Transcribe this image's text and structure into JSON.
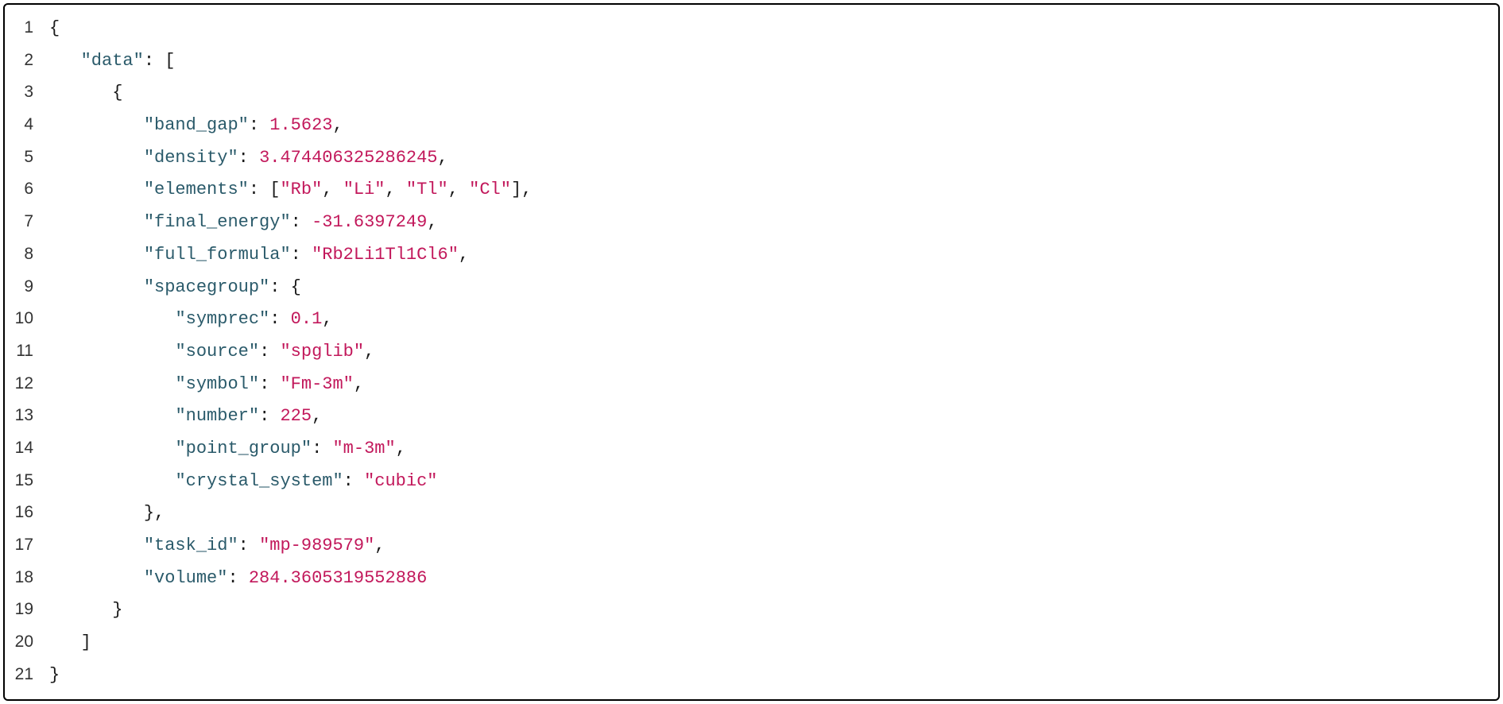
{
  "lines": [
    {
      "num": "1",
      "indent": 0,
      "tokens": [
        {
          "t": "punct",
          "v": "{"
        }
      ]
    },
    {
      "num": "2",
      "indent": 1,
      "tokens": [
        {
          "t": "key",
          "v": "\"data\""
        },
        {
          "t": "colon",
          "v": ": "
        },
        {
          "t": "punct",
          "v": "["
        }
      ]
    },
    {
      "num": "3",
      "indent": 2,
      "tokens": [
        {
          "t": "punct",
          "v": "{"
        }
      ]
    },
    {
      "num": "4",
      "indent": 3,
      "tokens": [
        {
          "t": "key",
          "v": "\"band_gap\""
        },
        {
          "t": "colon",
          "v": ": "
        },
        {
          "t": "number",
          "v": "1.5623"
        },
        {
          "t": "punct",
          "v": ","
        }
      ]
    },
    {
      "num": "5",
      "indent": 3,
      "tokens": [
        {
          "t": "key",
          "v": "\"density\""
        },
        {
          "t": "colon",
          "v": ": "
        },
        {
          "t": "number",
          "v": "3.474406325286245"
        },
        {
          "t": "punct",
          "v": ","
        }
      ]
    },
    {
      "num": "6",
      "indent": 3,
      "tokens": [
        {
          "t": "key",
          "v": "\"elements\""
        },
        {
          "t": "colon",
          "v": ": "
        },
        {
          "t": "punct",
          "v": "["
        },
        {
          "t": "string",
          "v": "\"Rb\""
        },
        {
          "t": "punct",
          "v": ", "
        },
        {
          "t": "string",
          "v": "\"Li\""
        },
        {
          "t": "punct",
          "v": ", "
        },
        {
          "t": "string",
          "v": "\"Tl\""
        },
        {
          "t": "punct",
          "v": ", "
        },
        {
          "t": "string",
          "v": "\"Cl\""
        },
        {
          "t": "punct",
          "v": "],"
        }
      ]
    },
    {
      "num": "7",
      "indent": 3,
      "tokens": [
        {
          "t": "key",
          "v": "\"final_energy\""
        },
        {
          "t": "colon",
          "v": ": "
        },
        {
          "t": "number",
          "v": "-31.6397249"
        },
        {
          "t": "punct",
          "v": ","
        }
      ]
    },
    {
      "num": "8",
      "indent": 3,
      "tokens": [
        {
          "t": "key",
          "v": "\"full_formula\""
        },
        {
          "t": "colon",
          "v": ": "
        },
        {
          "t": "string",
          "v": "\"Rb2Li1Tl1Cl6\""
        },
        {
          "t": "punct",
          "v": ","
        }
      ]
    },
    {
      "num": "9",
      "indent": 3,
      "tokens": [
        {
          "t": "key",
          "v": "\"spacegroup\""
        },
        {
          "t": "colon",
          "v": ": "
        },
        {
          "t": "punct",
          "v": "{"
        }
      ]
    },
    {
      "num": "10",
      "indent": 4,
      "tokens": [
        {
          "t": "key",
          "v": "\"symprec\""
        },
        {
          "t": "colon",
          "v": ": "
        },
        {
          "t": "number",
          "v": "0.1"
        },
        {
          "t": "punct",
          "v": ","
        }
      ]
    },
    {
      "num": "11",
      "indent": 4,
      "tokens": [
        {
          "t": "key",
          "v": "\"source\""
        },
        {
          "t": "colon",
          "v": ": "
        },
        {
          "t": "string",
          "v": "\"spglib\""
        },
        {
          "t": "punct",
          "v": ","
        }
      ]
    },
    {
      "num": "12",
      "indent": 4,
      "tokens": [
        {
          "t": "key",
          "v": "\"symbol\""
        },
        {
          "t": "colon",
          "v": ": "
        },
        {
          "t": "string",
          "v": "\"Fm-3m\""
        },
        {
          "t": "punct",
          "v": ","
        }
      ]
    },
    {
      "num": "13",
      "indent": 4,
      "tokens": [
        {
          "t": "key",
          "v": "\"number\""
        },
        {
          "t": "colon",
          "v": ": "
        },
        {
          "t": "number",
          "v": "225"
        },
        {
          "t": "punct",
          "v": ","
        }
      ]
    },
    {
      "num": "14",
      "indent": 4,
      "tokens": [
        {
          "t": "key",
          "v": "\"point_group\""
        },
        {
          "t": "colon",
          "v": ": "
        },
        {
          "t": "string",
          "v": "\"m-3m\""
        },
        {
          "t": "punct",
          "v": ","
        }
      ]
    },
    {
      "num": "15",
      "indent": 4,
      "tokens": [
        {
          "t": "key",
          "v": "\"crystal_system\""
        },
        {
          "t": "colon",
          "v": ": "
        },
        {
          "t": "string",
          "v": "\"cubic\""
        }
      ]
    },
    {
      "num": "16",
      "indent": 3,
      "tokens": [
        {
          "t": "punct",
          "v": "},"
        }
      ]
    },
    {
      "num": "17",
      "indent": 3,
      "tokens": [
        {
          "t": "key",
          "v": "\"task_id\""
        },
        {
          "t": "colon",
          "v": ": "
        },
        {
          "t": "string",
          "v": "\"mp-989579\""
        },
        {
          "t": "punct",
          "v": ","
        }
      ]
    },
    {
      "num": "18",
      "indent": 3,
      "tokens": [
        {
          "t": "key",
          "v": "\"volume\""
        },
        {
          "t": "colon",
          "v": ": "
        },
        {
          "t": "number",
          "v": "284.3605319552886"
        }
      ]
    },
    {
      "num": "19",
      "indent": 2,
      "tokens": [
        {
          "t": "punct",
          "v": "}"
        }
      ]
    },
    {
      "num": "20",
      "indent": 1,
      "tokens": [
        {
          "t": "punct",
          "v": "]"
        }
      ]
    },
    {
      "num": "21",
      "indent": 0,
      "tokens": [
        {
          "t": "punct",
          "v": "}"
        }
      ]
    }
  ],
  "indentUnit": "   "
}
